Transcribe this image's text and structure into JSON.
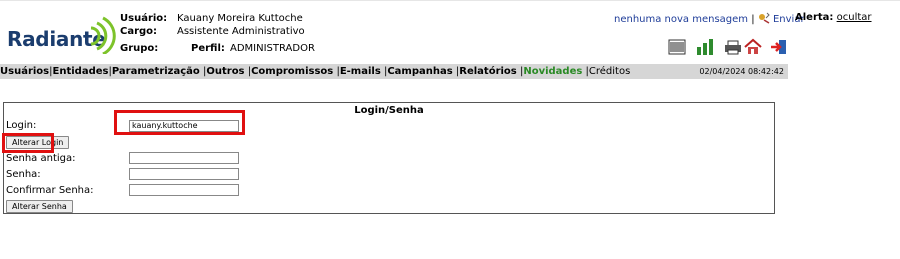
{
  "brand": {
    "name": "Radiante"
  },
  "user": {
    "usuario_label": "Usuário:",
    "usuario_value": "Kauany Moreira Kuttoche",
    "cargo_label": "Cargo:",
    "cargo_value": "Assistente Administrativo",
    "grupo_label": "Grupo:",
    "perfil_label": "Perfil:",
    "perfil_value": "ADMINISTRADOR"
  },
  "header": {
    "messages": "nenhuma nova mensagem",
    "separator": "|",
    "send": "Enviar",
    "alert_label": "Alerta:",
    "alert_link": "ocultar"
  },
  "toolbar_icons": [
    "barcode-icon",
    "chart-icon",
    "printer-icon",
    "home-icon",
    "exit-icon"
  ],
  "menu": {
    "items": [
      {
        "label": "Usuários"
      },
      {
        "label": "Entidades"
      },
      {
        "label": "Parametrização"
      },
      {
        "label": "Outros"
      },
      {
        "label": "Compromissos"
      },
      {
        "label": "E-mails"
      },
      {
        "label": "Campanhas"
      },
      {
        "label": "Relatórios"
      },
      {
        "label": "Novidades"
      },
      {
        "label": "Créditos"
      }
    ],
    "separator": "|",
    "datetime": "02/04/2024 08:42:42"
  },
  "form": {
    "title": "Login/Senha",
    "login_label": "Login:",
    "login_value": "kauany.kuttoche",
    "change_login_button": "Alterar Login",
    "old_password_label": "Senha antiga:",
    "password_label": "Senha:",
    "confirm_label": "Confirmar Senha:",
    "change_password_button": "Alterar Senha"
  },
  "colors": {
    "menu_bg": "#d6d6d6",
    "active_menu": "#2a8a25",
    "highlight": "#e01010",
    "brand": "#1b3d6e",
    "logo_green": "#7dc32a"
  }
}
